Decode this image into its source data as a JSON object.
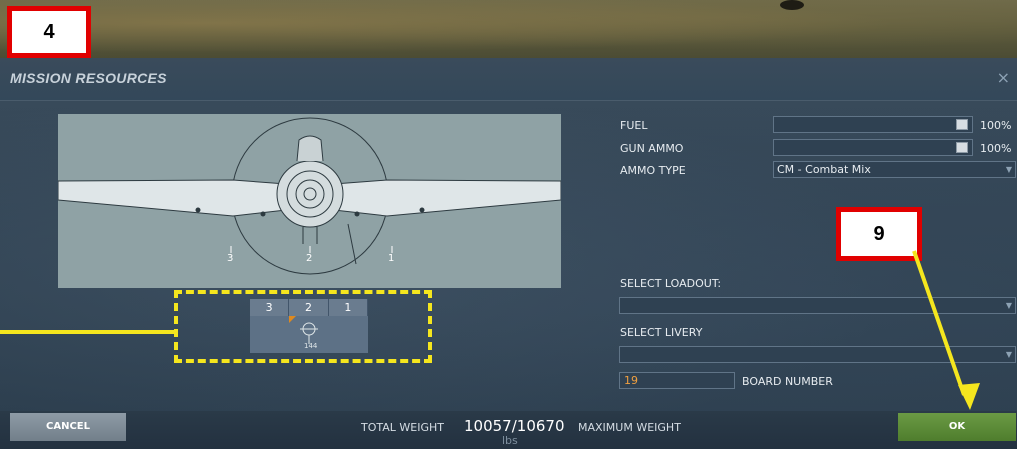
{
  "callouts": {
    "four": "4",
    "nine": "9"
  },
  "dialog": {
    "title": "MISSION RESOURCES",
    "close_icon": "×"
  },
  "loadout_slots": [
    "3",
    "2",
    "1"
  ],
  "hardpoint_labels": [
    "3",
    "2",
    "1"
  ],
  "slot_item_label": "144",
  "fuel": {
    "label": "FUEL",
    "value_pct": "100%",
    "level": 1.0
  },
  "gun_ammo": {
    "label": "GUN AMMO",
    "value_pct": "100%",
    "level": 1.0
  },
  "ammo_type": {
    "label": "AMMO TYPE",
    "value": "CM - Combat Mix"
  },
  "select_loadout": {
    "label": "SELECT LOADOUT:",
    "value": ""
  },
  "select_livery": {
    "label": "SELECT LIVERY",
    "value": ""
  },
  "board_number": {
    "label": "BOARD NUMBER",
    "value": "19"
  },
  "footer": {
    "cancel_label": "CANCEL",
    "ok_label": "OK",
    "total_weight_label": "TOTAL WEIGHT",
    "total_weight_value": "10057/10670",
    "weight_unit": "lbs",
    "max_weight_label": "MAXIMUM WEIGHT"
  },
  "colors": {
    "callout_border": "#e10000",
    "highlight_yellow": "#f5e61e",
    "ok_green": "#5a8a36",
    "board_number_text": "#f0a040"
  }
}
